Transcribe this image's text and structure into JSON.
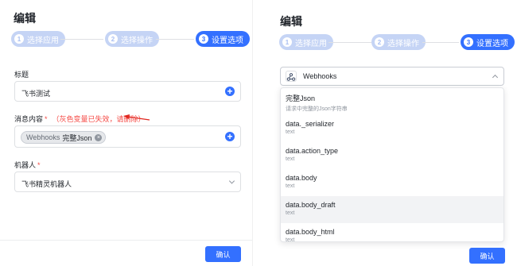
{
  "left": {
    "title": "编辑",
    "steps": [
      {
        "num": "1",
        "label": "选择应用"
      },
      {
        "num": "2",
        "label": "选择操作"
      },
      {
        "num": "3",
        "label": "设置选项"
      }
    ],
    "title_field": {
      "label": "标题",
      "value": "飞书测试"
    },
    "message_field": {
      "label": "消息内容",
      "required_mark": "*",
      "warning": "（灰色变量已失效，请删除）",
      "chip_source": "Webhooks",
      "chip_value": "完整Json",
      "chip_remove": "×"
    },
    "robot_field": {
      "label": "机器人",
      "required_mark": "*",
      "value": "飞书精灵机器人"
    },
    "plus_glyph": "+",
    "confirm_label": "确认"
  },
  "right": {
    "title": "编辑",
    "steps": [
      {
        "num": "1",
        "label": "选择应用"
      },
      {
        "num": "2",
        "label": "选择操作"
      },
      {
        "num": "3",
        "label": "设置选项"
      }
    ],
    "source_select": {
      "value": "Webhooks"
    },
    "options": [
      {
        "name": "完整Json",
        "type": "请求中完整的Json字符串"
      },
      {
        "name": "data._serializer",
        "type": "text"
      },
      {
        "name": "data.action_type",
        "type": "text"
      },
      {
        "name": "data.body",
        "type": "text"
      },
      {
        "name": "data.body_draft",
        "type": "text"
      },
      {
        "name": "data.body_html",
        "type": "text"
      }
    ],
    "confirm_label": "确认"
  },
  "colors": {
    "accent": "#3370ff",
    "step_done": "#c5d4f5",
    "danger": "#f54a45",
    "hover": "#f2f3f5"
  }
}
